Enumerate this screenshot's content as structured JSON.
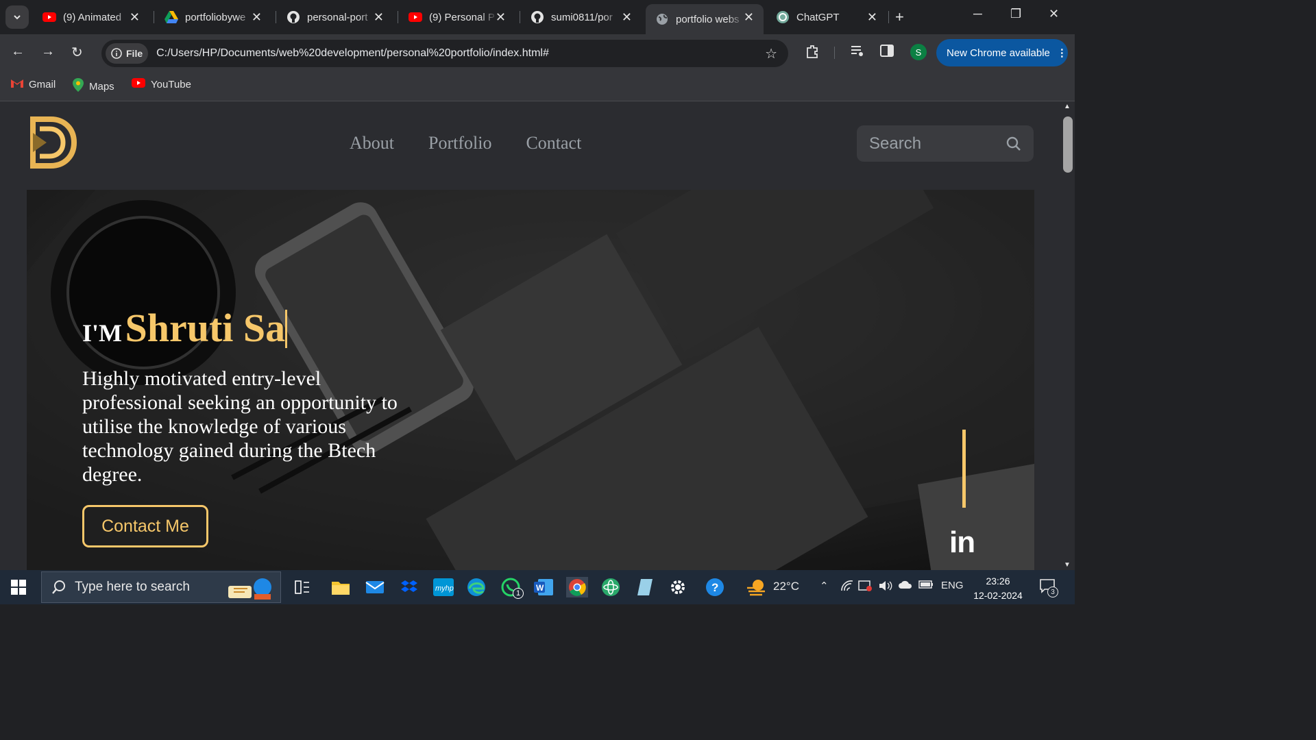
{
  "browser": {
    "tabs": [
      {
        "title": "(9) Animated",
        "icon": "youtube-icon"
      },
      {
        "title": "portfoliobywe",
        "icon": "google-drive-icon"
      },
      {
        "title": "personal-port",
        "icon": "github-icon"
      },
      {
        "title": "(9) Personal P",
        "icon": "youtube-icon"
      },
      {
        "title": "sumi0811/por",
        "icon": "github-icon"
      },
      {
        "title": "portfolio webs",
        "icon": "globe-icon",
        "active": true
      },
      {
        "title": "ChatGPT",
        "icon": "chatgpt-icon"
      }
    ],
    "address": {
      "chip_label": "File",
      "url": "C:/Users/HP/Documents/web%20development/personal%20portfolio/index.html#"
    },
    "profile_initial": "S",
    "update_label": "New Chrome available",
    "bookmarks": [
      {
        "label": "Gmail",
        "icon": "gmail-icon"
      },
      {
        "label": "Maps",
        "icon": "maps-icon"
      },
      {
        "label": "YouTube",
        "icon": "youtube-icon"
      }
    ]
  },
  "site": {
    "nav": [
      "About",
      "Portfolio",
      "Contact"
    ],
    "search_placeholder": "Search",
    "hero": {
      "prefix": "I'M",
      "name": "Shruti Sa",
      "description": "Highly motivated entry-level professional seeking an opportunity to utilise the knowledge of various technology gained during the Btech degree.",
      "cta": "Contact Me",
      "social": "in"
    },
    "accent_color": "#f6c76a"
  },
  "taskbar": {
    "search_placeholder": "Type here to search",
    "whatsapp_badge": "1",
    "weather": "22°C",
    "language": "ENG",
    "time": "23:26",
    "date": "12-02-2024",
    "notification_count": "3"
  }
}
